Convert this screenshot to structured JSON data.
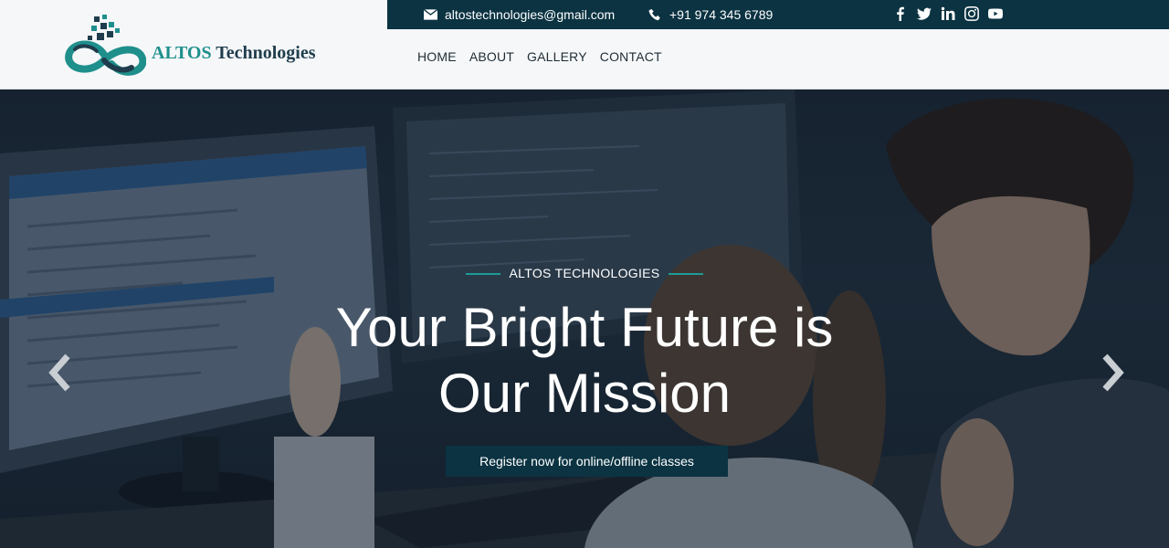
{
  "logo": {
    "brand": "ALTOS",
    "rest": "Technologies"
  },
  "topbar": {
    "email": "altostechnologies@gmail.com",
    "phone": "+91 974 345 6789",
    "socials": [
      "facebook-icon",
      "twitter-icon",
      "linkedin-icon",
      "instagram-icon",
      "youtube-icon"
    ]
  },
  "nav": {
    "items": [
      "HOME",
      "ABOUT",
      "GALLERY",
      "CONTACT"
    ]
  },
  "hero": {
    "eyebrow": "ALTOS TECHNOLOGIES",
    "headline_line1": "Your Bright Future is",
    "headline_line2": "Our Mission",
    "cta": "Register now for online/offline classes"
  },
  "colors": {
    "primary": "#0b3342",
    "accent": "#1d9a96"
  }
}
